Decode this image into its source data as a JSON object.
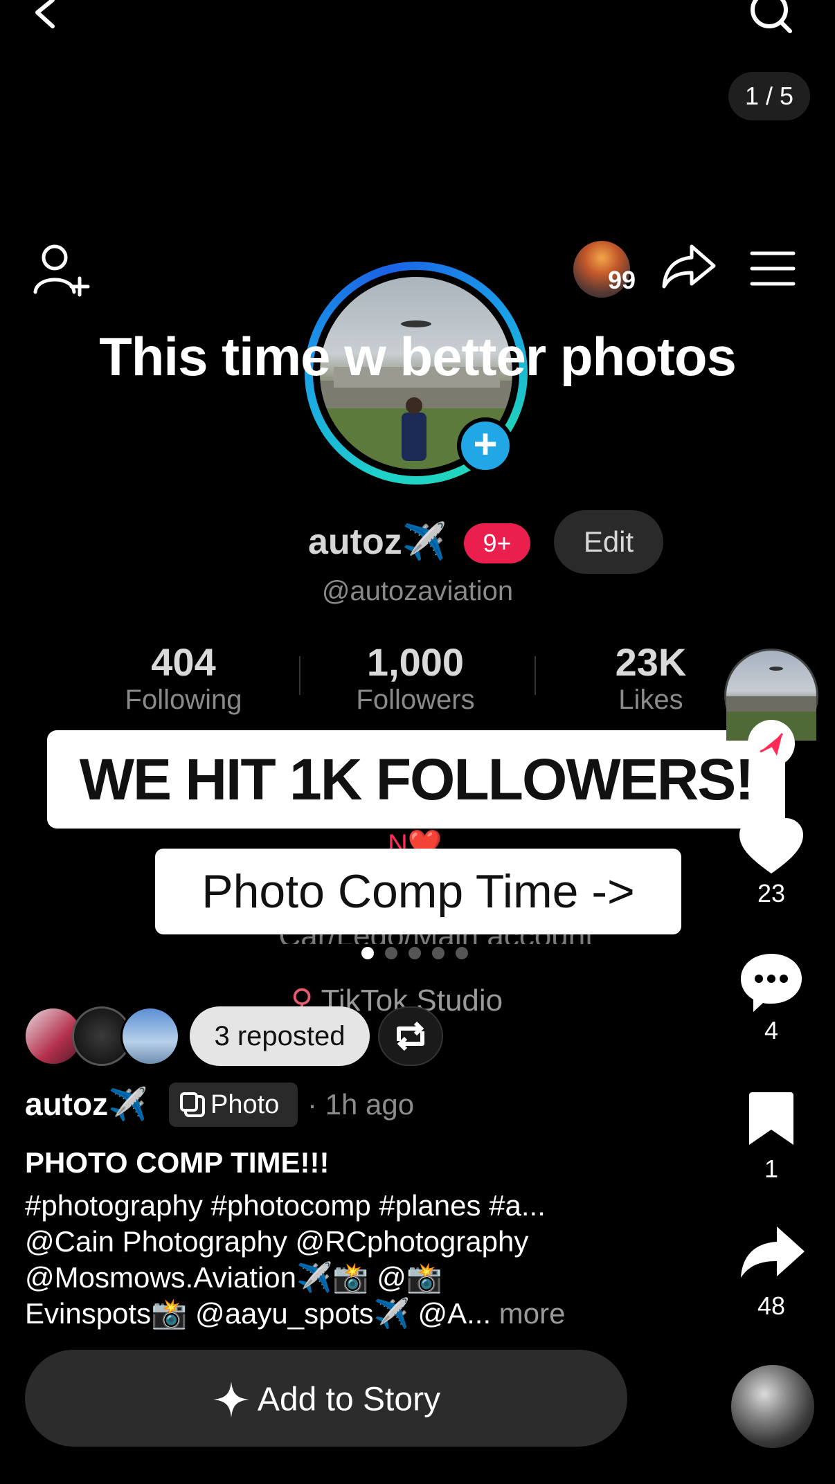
{
  "page_counter": "1 / 5",
  "overlay_title": "This time w better photos",
  "profile": {
    "story_count": "99",
    "name": "autoz✈️",
    "notification_badge": "9+",
    "edit_label": "Edit",
    "handle": "@autozaviation",
    "stats": [
      {
        "value": "404",
        "label": "Following"
      },
      {
        "value": "1,000",
        "label": "Followers"
      },
      {
        "value": "23K",
        "label": "Likes"
      }
    ],
    "bio_peek": "Car/Lego/Main account @autozzz",
    "studio_label": "TikTok Studio"
  },
  "banners": {
    "milestone": "WE HIT 1K FOLLOWERS!",
    "comp": "Photo Comp Time ->"
  },
  "carousel": {
    "total": 5,
    "active": 1
  },
  "reposted_label": "3 reposted",
  "post": {
    "author": "autoz✈️",
    "type_tag": "Photo",
    "time": "· 1h ago",
    "caption_title": "PHOTO COMP TIME!!!",
    "caption_lines": [
      "#photography #photocomp #planes #a...",
      "@Cain Photography @RCphotography",
      "@Mosmows.Aviation✈️📸 @📸",
      "Evinspots📸 @aayu_spots✈️ @A..."
    ],
    "more_label": " more"
  },
  "add_story_label": "Add to Story",
  "rail": {
    "likes": "23",
    "comments": "4",
    "saves": "1",
    "shares": "48"
  },
  "colors": {
    "ring_accent": "#1a9fe8",
    "badge_red": "#ea1f4d",
    "follow_red": "#fe2c55"
  }
}
